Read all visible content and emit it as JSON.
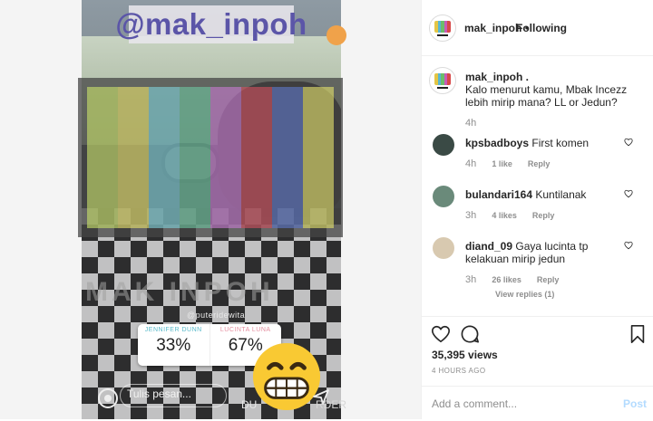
{
  "story": {
    "handle": "@mak_inpoh",
    "watermark": "MAK INPOH",
    "credit": "@puteridewita",
    "colorbars": [
      "#c8e06a",
      "#e9e26e",
      "#7fd1d8",
      "#6ec5a0",
      "#c77ad0",
      "#d0505f",
      "#5e78c8",
      "#e2e06c"
    ],
    "poll": {
      "option1_name": "JENNIFER DUNN",
      "option1_pct": "33%",
      "option1_color": "#58b9c9",
      "option2_name": "LUCINTA LUNA",
      "option2_pct": "67%",
      "option2_color": "#e58fa0"
    },
    "reply_placeholder": "Tulis pesan...",
    "bottom_right_a": "DU",
    "bottom_right_b": "RDER"
  },
  "header": {
    "username": "mak_inpoh",
    "separator": "•",
    "follow_status": "Following"
  },
  "caption": {
    "username": "mak_inpoh .",
    "text": "Kalo menurut kamu, Mbak Incezz lebih mirip mana? LL or Jedun?",
    "time": "4h"
  },
  "comments": [
    {
      "username": "kpsbadboys",
      "text": "First komen",
      "line2": "",
      "time": "4h",
      "likes": "1 like",
      "reply": "Reply",
      "avatar_color": "#3a4a45"
    },
    {
      "username": "bulandari164",
      "text": "Kuntilanak",
      "line2": "",
      "time": "3h",
      "likes": "4 likes",
      "reply": "Reply",
      "avatar_color": "#6a8a7a"
    },
    {
      "username": "diand_09",
      "text": "Gaya lucinta tp",
      "line2": "kelakuan mirip jedun",
      "time": "3h",
      "likes": "26 likes",
      "reply": "Reply",
      "avatar_color": "#d8c9b0"
    }
  ],
  "view_replies": "View replies (1)",
  "footer": {
    "views": "35,395 views",
    "post_time": "4 HOURS AGO",
    "add_comment_placeholder": "Add a comment...",
    "post_label": "Post"
  },
  "icons": {
    "heart": "heart-icon",
    "comment": "comment-icon",
    "save": "bookmark-icon",
    "camera": "camera-icon",
    "send": "send-icon",
    "emoji": "grinning-emoji"
  },
  "colors": {
    "link_post": "#b3dbff",
    "muted": "#8e8e8e",
    "text": "#262626",
    "handle_text": "#5b55a8"
  }
}
